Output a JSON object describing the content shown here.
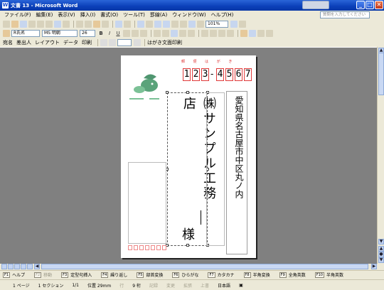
{
  "window": {
    "title": "文書 13 - Microsoft Word",
    "minimize": "_",
    "maximize": "□",
    "close": "✕"
  },
  "menu": [
    "ファイル(F)",
    "編集(E)",
    "表示(V)",
    "挿入(I)",
    "書式(O)",
    "ツール(T)",
    "罫線(A)",
    "ウィンドウ(W)",
    "ヘルプ(H)"
  ],
  "help_placeholder": "質問を入力してください",
  "toolbar": {
    "zoom": "101%",
    "style": "R氏名",
    "font": "MS 明朝",
    "size": "26",
    "text_labels": [
      "宛名",
      "差出人",
      "レイアウト",
      "データ",
      "印刷"
    ],
    "postcard_button": "はがき文面印刷"
  },
  "postcard": {
    "postal_label": "郵 便 は が き",
    "postal_code_digits": [
      "1",
      "2",
      "3",
      "4",
      "5",
      "6",
      "7"
    ],
    "postal_dash": "-",
    "address": "愛知県名古屋市中区丸ノ内",
    "company_name": "㈱サンプル工務店",
    "honorific": "様"
  },
  "fkeys": [
    {
      "key": "F1",
      "label": "ヘルプ",
      "enabled": true
    },
    {
      "key": "F2",
      "label": "移動",
      "enabled": false
    },
    {
      "key": "F3",
      "label": "定型句挿入",
      "enabled": true
    },
    {
      "key": "F4",
      "label": "繰り返し",
      "enabled": true
    },
    {
      "key": "F5",
      "label": "部首変換",
      "enabled": true
    },
    {
      "key": "F6",
      "label": "ひらがな",
      "enabled": true
    },
    {
      "key": "F7",
      "label": "カタカナ",
      "enabled": true
    },
    {
      "key": "F8",
      "label": "半角変換",
      "enabled": true
    },
    {
      "key": "F9",
      "label": "全角英数",
      "enabled": true
    },
    {
      "key": "F10",
      "label": "半角英数",
      "enabled": true
    }
  ],
  "status": {
    "page": "1 ページ",
    "section": "1 セクション",
    "pages": "1/1",
    "position": "位置 29mm",
    "line": "行",
    "column": "9 桁",
    "rec": "記録",
    "trk": "変更",
    "ext": "拡張",
    "ovr": "上書",
    "language": "日本語"
  }
}
